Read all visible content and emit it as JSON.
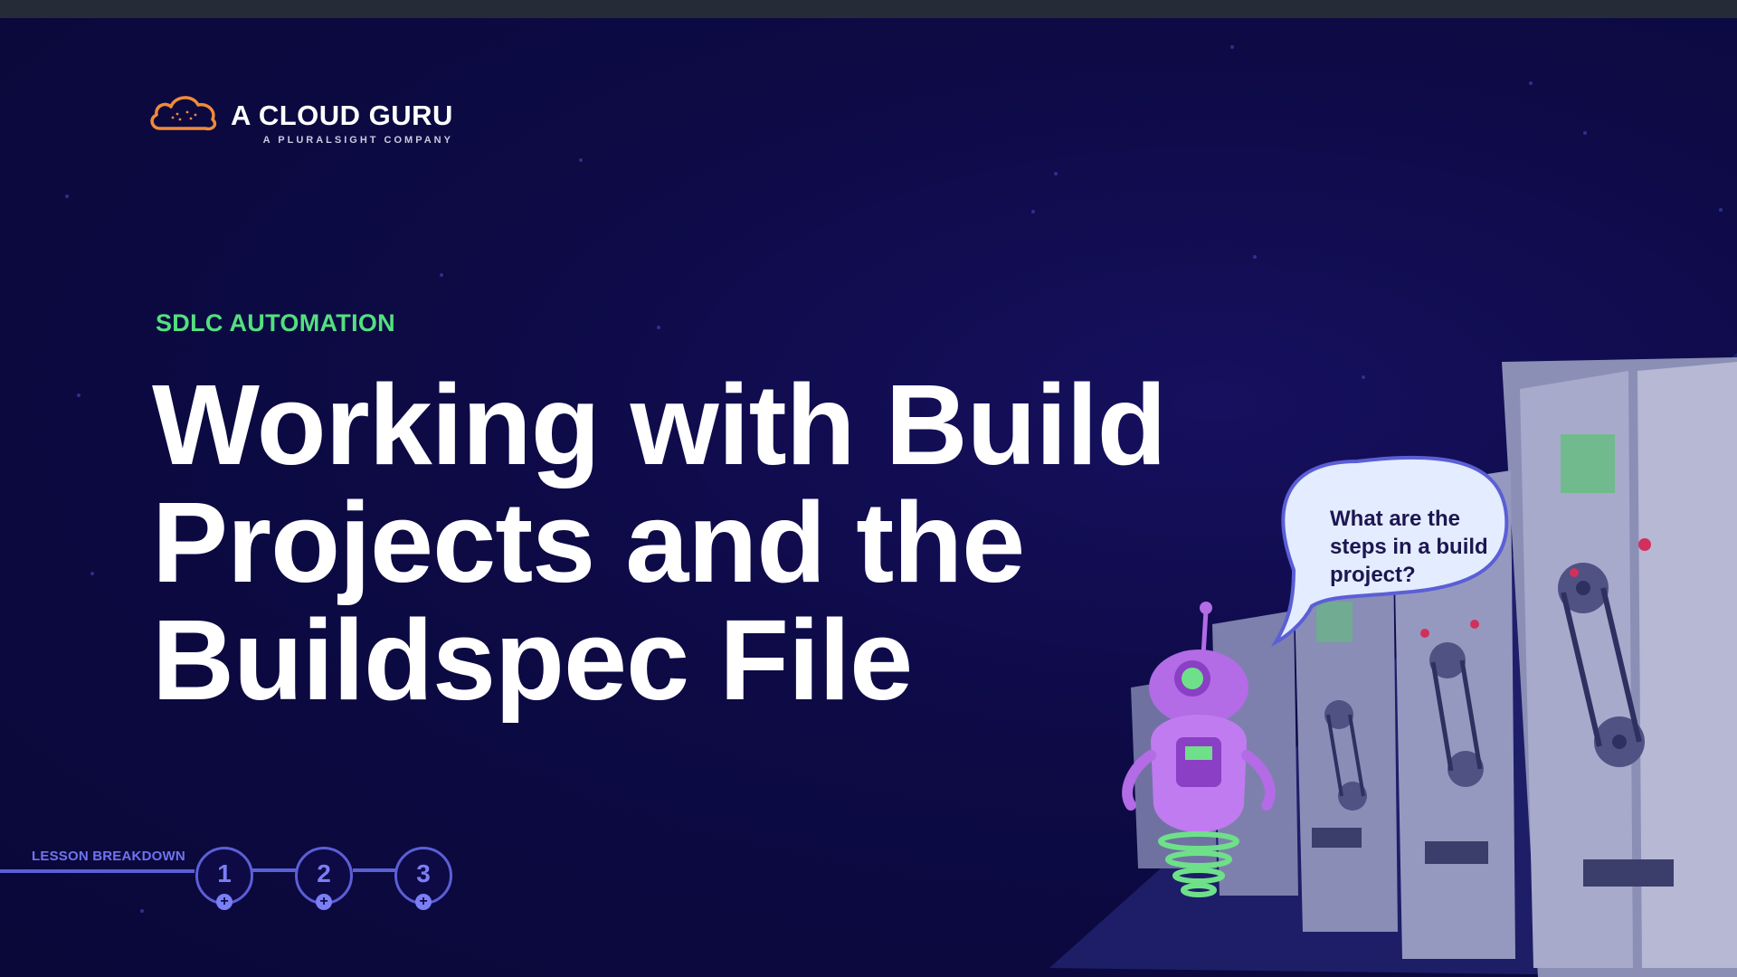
{
  "logo": {
    "name": "A CLOUD GURU",
    "tagline": "A PLURALSIGHT COMPANY",
    "icon": "cloud-logo-icon"
  },
  "course": {
    "category": "SDLC AUTOMATION",
    "title_lines": [
      "Working with Build",
      "Projects and the",
      "Buildspec File"
    ]
  },
  "lesson_breakdown": {
    "label": "LESSON BREAKDOWN",
    "steps": [
      "1",
      "2",
      "3"
    ],
    "expand_icon": "+"
  },
  "illustration": {
    "speech_bubble": "What are the steps in a build project?",
    "robot_icon": "robot-icon",
    "servers_icon": "server-rack-icon"
  },
  "colors": {
    "background": "#0d0a45",
    "accent_green": "#53e07f",
    "accent_blue": "#5b5fd6",
    "title": "#ffffff"
  }
}
